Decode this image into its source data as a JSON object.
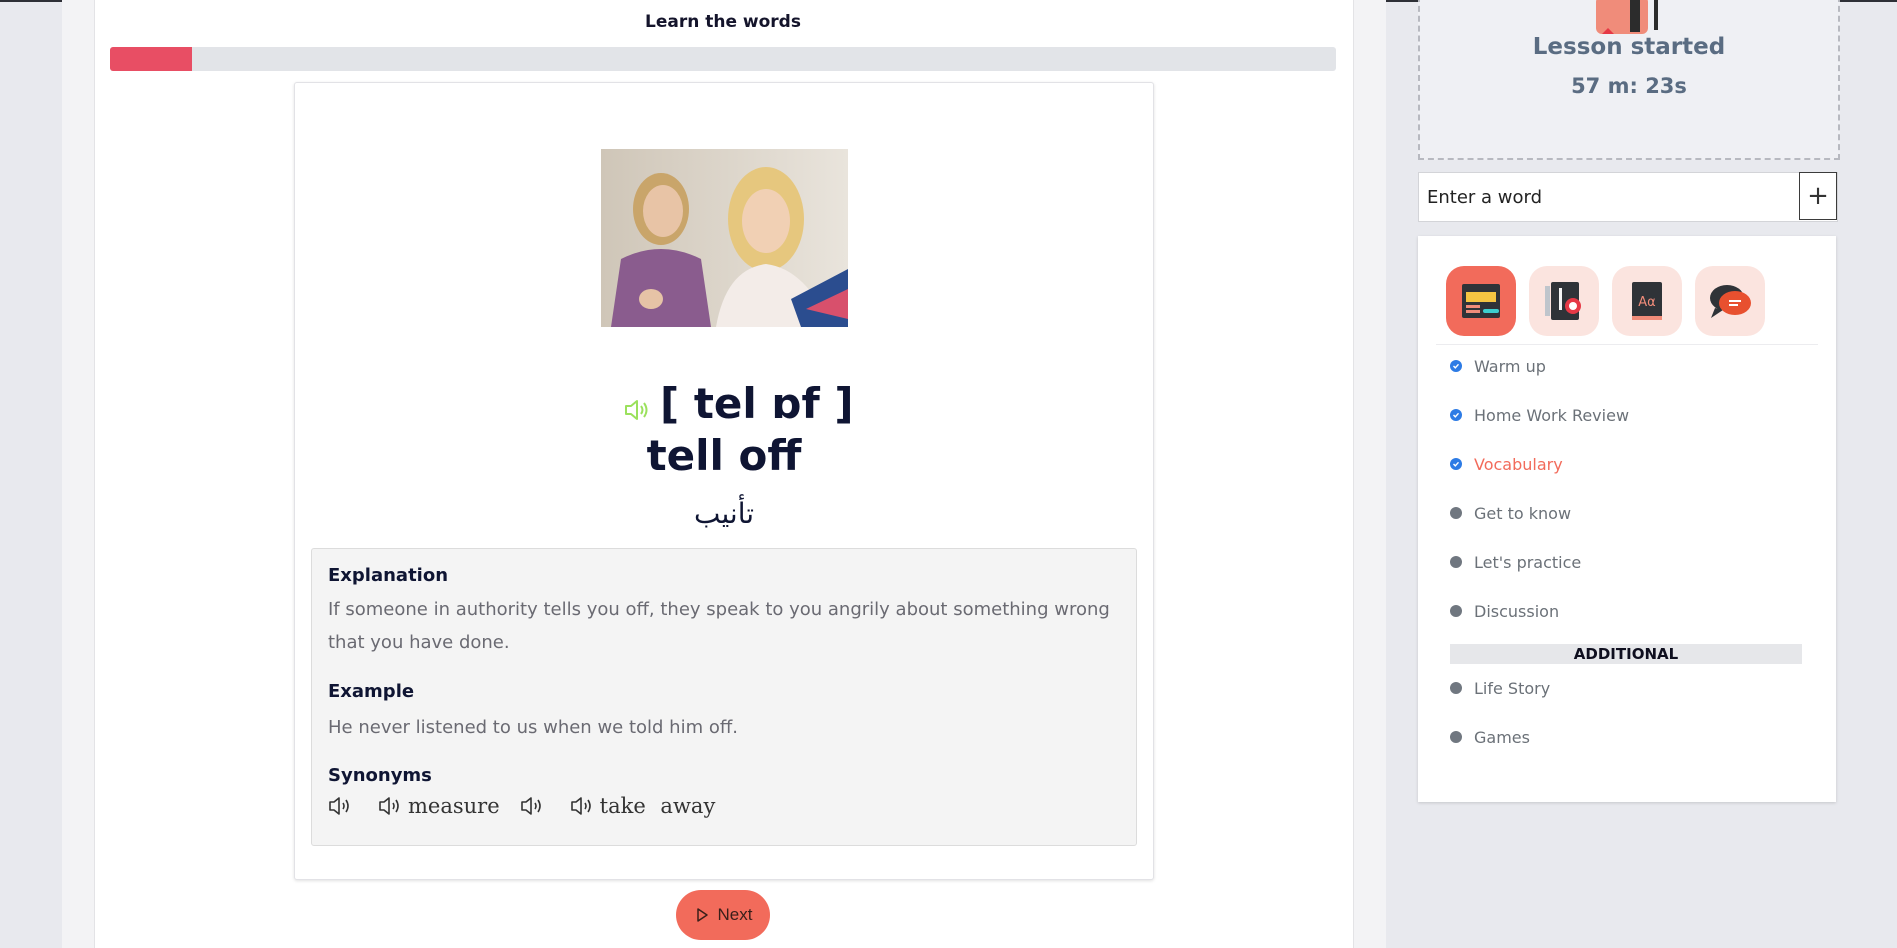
{
  "lesson": {
    "title": "Learn the words",
    "progress_percent": 6.7
  },
  "word_card": {
    "phonetic": "[ tel ɒf ]",
    "word": "tell off",
    "translation": "تأنيب",
    "explanation_heading": "Explanation",
    "explanation_text": "If someone in authority tells you off, they speak to you angrily about something wrong that you have done.",
    "example_heading": "Example",
    "example_text": "He never listened to us when we told him off.",
    "synonyms_heading": "Synonyms",
    "synonyms": [
      "",
      "measure",
      "",
      "take away"
    ]
  },
  "next_button": {
    "label": "Next"
  },
  "timer": {
    "label": "Lesson started",
    "value": "57 m: 23s"
  },
  "word_input": {
    "placeholder": "Enter a word",
    "add_label": "+"
  },
  "app_icons": [
    "browser-icon",
    "notebook-icon",
    "dictionary-icon",
    "chat-icon"
  ],
  "menu": {
    "items": [
      {
        "label": "Warm up",
        "status": "done"
      },
      {
        "label": "Home Work Review",
        "status": "done"
      },
      {
        "label": "Vocabulary",
        "status": "current"
      },
      {
        "label": "Get to know",
        "status": "pending"
      },
      {
        "label": "Let's practice",
        "status": "pending"
      },
      {
        "label": "Discussion",
        "status": "pending"
      }
    ],
    "additional_header": "ADDITIONAL",
    "additional_items": [
      {
        "label": "Life Story",
        "status": "pending"
      },
      {
        "label": "Games",
        "status": "pending"
      }
    ]
  },
  "colors": {
    "accent": "#f26b5b",
    "progress": "#e84e64",
    "check": "#2d7be5",
    "audio_green": "#9be15d"
  }
}
